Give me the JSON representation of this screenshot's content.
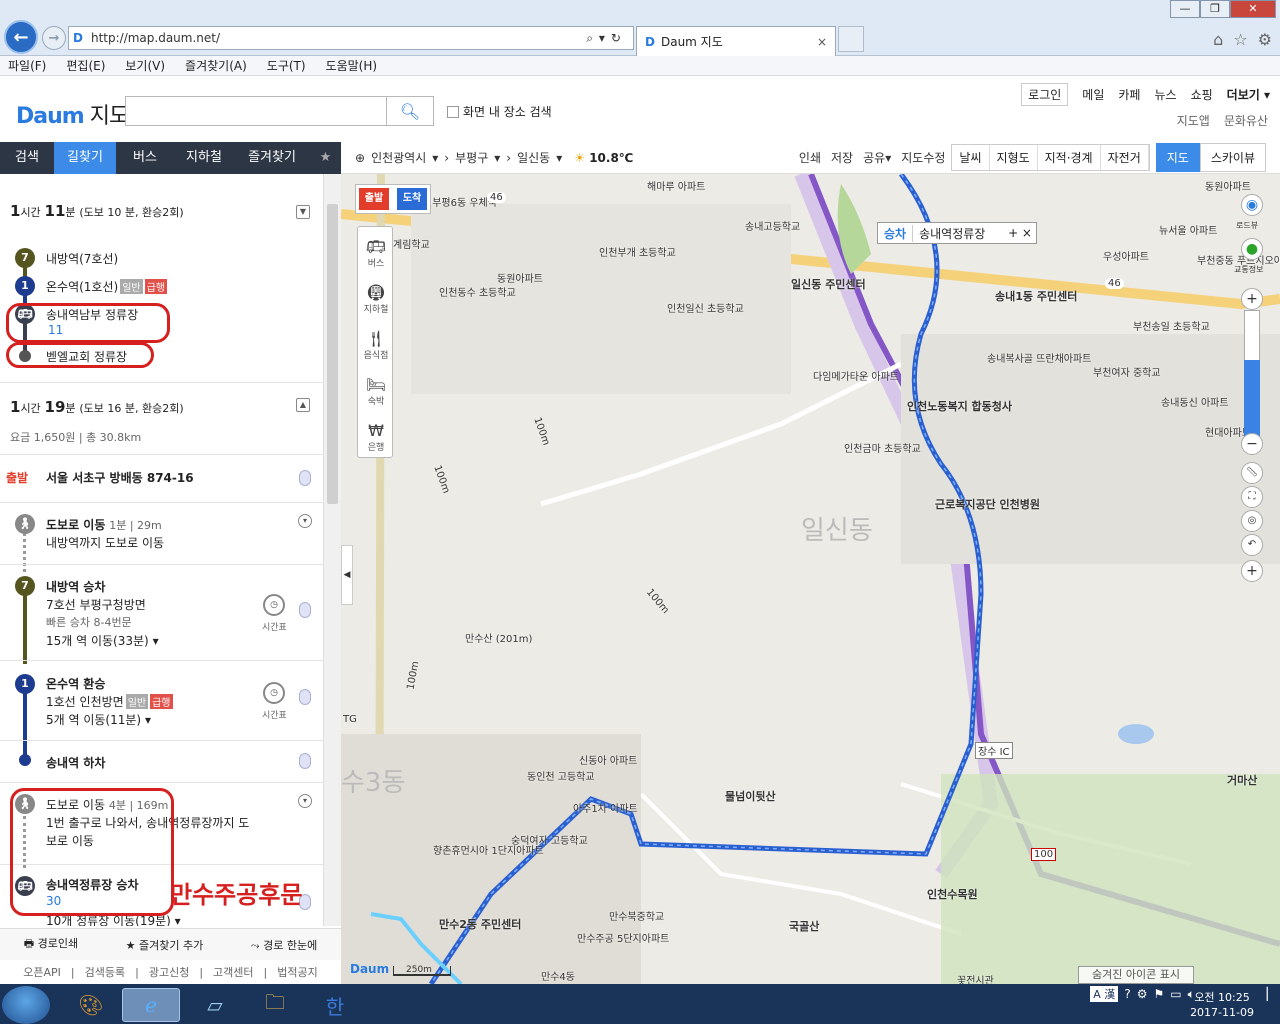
{
  "browser": {
    "url": "http://map.daum.net/",
    "tab_title": "Daum 지도",
    "tab_close": "×",
    "menu": [
      "파일(F)",
      "편집(E)",
      "보기(V)",
      "즐겨찾기(A)",
      "도구(T)",
      "도움말(H)"
    ]
  },
  "header": {
    "logo": "Daum",
    "service": "지도",
    "search_placeholder": "",
    "scope_label": "화면 내 장소 검색",
    "links": [
      "로그인",
      "메일",
      "카페",
      "뉴스",
      "쇼핑",
      "더보기"
    ],
    "sub_links": [
      "지도앱",
      "문화유산"
    ]
  },
  "left_tabs": [
    "검색",
    "길찾기",
    "버스",
    "지하철",
    "즐겨찾기"
  ],
  "route1": {
    "time_h": "1",
    "time_h_unit": "시간",
    "time_m": "11",
    "time_m_unit": "분",
    "detail": "(도보 10 분, 환승2회)",
    "steps": [
      {
        "icon": "7",
        "name": "내방역(7호선)"
      },
      {
        "icon": "1",
        "name": "온수역(1호선)",
        "badges": [
          "일반",
          "급행"
        ]
      },
      {
        "icon": "bus",
        "name": "송내역남부 정류장",
        "sub": "11"
      },
      {
        "icon": "dot",
        "name": "벧엘교회 정류장"
      }
    ]
  },
  "route2": {
    "time_h": "1",
    "time_h_unit": "시간",
    "time_m": "19",
    "time_m_unit": "분",
    "detail": "(도보 16 분, 환승2회)",
    "fare": "요금 1,650원",
    "distance": "총 30.8km",
    "origin_tag": "출발",
    "origin": "서울 서초구 방배동 874-16",
    "steps": [
      {
        "title": "도보로 이동",
        "meta": "1분",
        "meta2": "29m",
        "line1": "내방역까지 도보로 이동"
      },
      {
        "title": "내방역 승차",
        "line1": "7호선 부평구청방면",
        "line2": "빠른 승차 8-4번문",
        "line3": "15개 역 이동(33분)",
        "clock": "시간표"
      },
      {
        "title": "온수역 환승",
        "line1": "1호선 인천방면",
        "badges": [
          "일반",
          "급행"
        ],
        "line3": "5개 역 이동(11분)",
        "clock": "시간표"
      },
      {
        "title": "송내역 하차"
      },
      {
        "title": "도보로 이동",
        "meta": "4분",
        "meta2": "169m",
        "line1": "1번 출구로 나와서, 송내역정류장까지 도",
        "line2": "보로 이동"
      },
      {
        "title": "송내역정류장 승차",
        "line1": "30",
        "line3": "10개 정류장 이동(19분)"
      }
    ]
  },
  "annotation": "만수주공후문",
  "left_bottom": [
    "경로인쇄",
    "즐겨찾기 추가",
    "경로 한눈에"
  ],
  "left_footer": [
    "오픈API",
    "검색등록",
    "광고신청",
    "고객센터",
    "법적공지"
  ],
  "map_toolbar": {
    "location": [
      "인천광역시",
      "부평구",
      "일신동"
    ],
    "weather": "10.8℃",
    "actions": [
      "인쇄",
      "저장",
      "공유",
      "지도수정"
    ],
    "layers": [
      "날씨",
      "지형도",
      "지적·경계",
      "자전거"
    ],
    "map_types": [
      "지도",
      "스카이뷰"
    ]
  },
  "map": {
    "start_flag": "출발",
    "end_flag": "도착",
    "poi_buttons": [
      "버스",
      "지하철",
      "음식점",
      "숙박",
      "은행"
    ],
    "chip_tag": "승차",
    "chip_name": "송내역정류장",
    "chip_controls": "+ ×",
    "right_ctrls": [
      "로드뷰",
      "교통정보"
    ],
    "labels": [
      "전부평6동 우체국",
      "해마루 아파트",
      "송내고등학교",
      "인천부개 초등학교",
      "동원아파트",
      "인천동수 초등학교",
      "인천일신 초등학교",
      "일신동 주민센터",
      "계림학교",
      "다임메가타운 아파트",
      "인천노동복지 합동청사",
      "인천금마 초등학교",
      "근로복지공단 인천병원",
      "일신동",
      "만수산 (201m)",
      "물넘이뒷산",
      "국골산",
      "인천수목원",
      "거마산",
      "장수 IC",
      "송내1동 주민센터",
      "송내복사골 뜨란채아파트",
      "부천송일 초등학교",
      "부천여자 중학교",
      "송내동신 아파트",
      "현대아파트",
      "우성아파트",
      "뉴서울 아파트",
      "부천중동 푸르지오아파트",
      "동원아파트",
      "동인천 고등학교",
      "신동아 아파트",
      "아주1차 아파트",
      "숭덕여자 고등학교",
      "향촌휴먼시아 1단지아파트",
      "만수2동 주민센터",
      "만수북중학교",
      "만수주공 5단지아파트",
      "만수4동",
      "꽃전시관",
      "100m",
      "100m",
      "100m",
      "100m",
      "46",
      "46",
      "100",
      "수3동",
      "TG"
    ],
    "scale": "250m",
    "hidden_icons": "숨겨진 아이콘 표시",
    "logo": "Daum"
  },
  "taskbar": {
    "time": "오전 10:25",
    "date": "2017-11-09",
    "ime": "A 漢"
  },
  "colors": {
    "accent": "#3d8be8",
    "line7": "#55561f",
    "line1": "#1d3b8f",
    "bus": "#3a3f4f",
    "highlight": "#d62020",
    "route_blue": "#2a5fd0",
    "route_purple": "#8456c6"
  }
}
